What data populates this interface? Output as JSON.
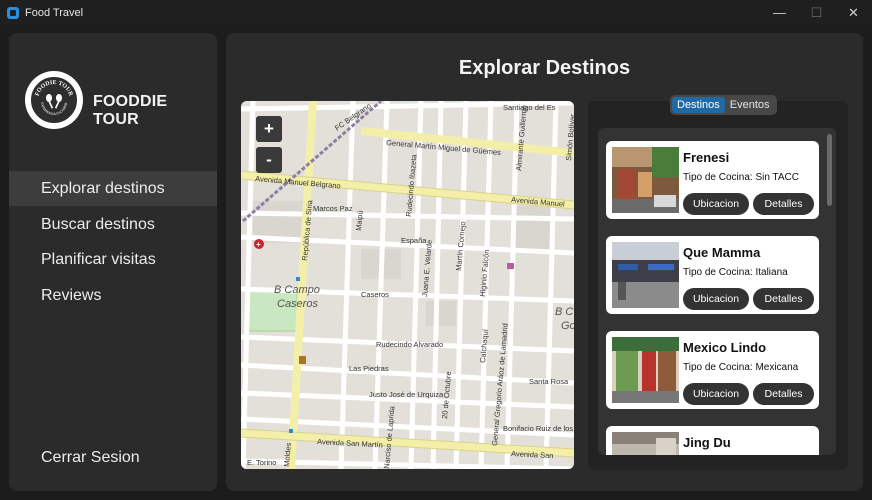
{
  "window": {
    "title": "Food Travel",
    "minimize": "—",
    "maximize": "☐",
    "close": "✕"
  },
  "sidebar": {
    "logo_text_top": "FOODIE TOUR",
    "logo_text_bottom": "EXPERIENCIA CULINARIA",
    "brand": "FOODDIE TOUR",
    "items": [
      {
        "label": "Explorar destinos",
        "active": true
      },
      {
        "label": "Buscar destinos",
        "active": false
      },
      {
        "label": "Planificar visitas",
        "active": false
      },
      {
        "label": "Reviews",
        "active": false
      }
    ],
    "logout": "Cerrar Sesion"
  },
  "main": {
    "title": "Explorar Destinos"
  },
  "map": {
    "zoom_in": "+",
    "zoom_out": "-",
    "labels": {
      "santiago": "Santiago del Es",
      "belgrano_fc": "FC Belgrano",
      "guemes": "General Martín Miguel de Güemes",
      "avenida_belgrano": "Avenida Manuel Belgrano",
      "avenida_manuel": "Avenida Manuel",
      "marcos_paz": "Marcos Paz",
      "espana": "España",
      "caseros": "Caseros",
      "campo": "B Campo",
      "campo2": "Caseros",
      "rudecindo": "Rudecindo Alvarado",
      "las_piedras": "Las Piedras",
      "santa_rosa": "Santa Rosa",
      "urquiza": "Justo José de Urquiza",
      "bonifacio": "Bonifacio Ruiz de los",
      "san_martin": "Avenida San Martín",
      "avenida_san": "Avenida San",
      "torino": "E. Torino",
      "moldes": "Moldes",
      "republica_siria": "República de Siria",
      "martin_cornejo": "Martín Cornejo",
      "juana_velarde": "Juana E. Velarde",
      "higinio": "Higinio Falcón",
      "calchaqui": "Calchaquí",
      "lamadrid": "General Gregorio Aráoz de Lamadrid",
      "octubre": "20 de Octubre",
      "laprida": "Narciso de Laprida",
      "rudecindo_v": "Rudecindo Ibazeta",
      "maipu": "Maipú",
      "almirante": "Almirante Guillermo",
      "simon": "Simón Bolívar",
      "b_c": "B C",
      "go": "Go"
    }
  },
  "tabs": [
    {
      "label": "Destinos",
      "active": true
    },
    {
      "label": "Eventos",
      "active": false
    }
  ],
  "destinations": [
    {
      "name": "Frenesi",
      "cuisine": "Tipo de Cocina: Sin TACC",
      "btn_location": "Ubicacion",
      "btn_details": "Detalles"
    },
    {
      "name": "Que Mamma",
      "cuisine": "Tipo de Cocina: Italiana",
      "btn_location": "Ubicacion",
      "btn_details": "Detalles"
    },
    {
      "name": "Mexico Lindo",
      "cuisine": "Tipo de Cocina: Mexicana",
      "btn_location": "Ubicacion",
      "btn_details": "Detalles"
    },
    {
      "name": "Jing Du"
    }
  ]
}
